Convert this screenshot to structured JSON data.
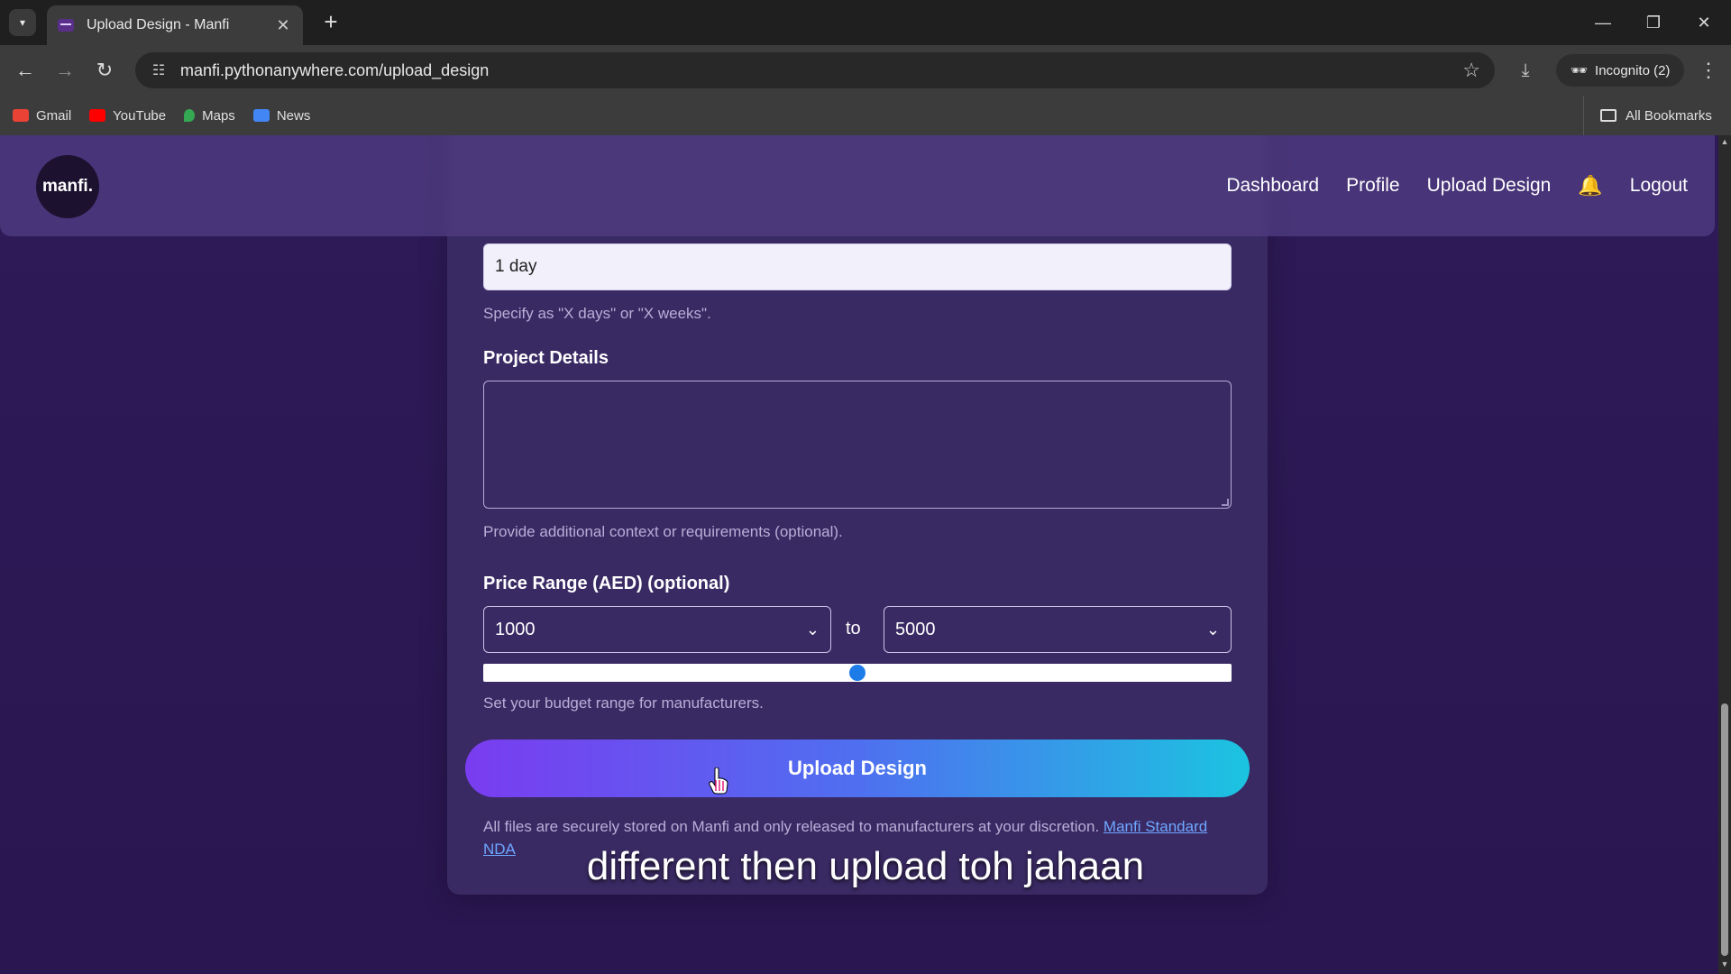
{
  "browser": {
    "tab_title": "Upload Design - Manfi",
    "url": "manfi.pythonanywhere.com/upload_design",
    "incognito_label": "Incognito (2)",
    "bookmarks": [
      {
        "label": "Gmail",
        "icon": "gmail-icon",
        "color": "#ea4335"
      },
      {
        "label": "YouTube",
        "icon": "youtube-icon",
        "color": "#ff0000"
      },
      {
        "label": "Maps",
        "icon": "maps-icon",
        "color": "#34a853"
      },
      {
        "label": "News",
        "icon": "news-icon",
        "color": "#4285f4"
      }
    ],
    "all_bookmarks_label": "All Bookmarks"
  },
  "navbar": {
    "logo_text": "manfi.",
    "links": [
      "Dashboard",
      "Profile",
      "Upload Design",
      "Logout"
    ]
  },
  "form": {
    "duration_value": "1 day",
    "duration_help": "Specify as \"X days\" or \"X weeks\".",
    "project_details_label": "Project Details",
    "project_details_value": "",
    "project_details_help": "Provide additional context or requirements (optional).",
    "price_range_label": "Price Range (AED) (optional)",
    "price_min": "1000",
    "price_to": "to",
    "price_max": "5000",
    "price_slider_fraction": 0.5,
    "price_help": "Set your budget range for manufacturers.",
    "submit_label": "Upload Design",
    "legal_text": "All files are securely stored on Manfi and only released to manufacturers at your discretion.",
    "legal_link": "Manfi Standard NDA"
  },
  "caption": "different then upload toh jahaan",
  "colors": {
    "accent_start": "#7a3cf0",
    "accent_end": "#1bc4e0",
    "page_bg": "#2e1a57",
    "link": "#6ea7ff"
  }
}
